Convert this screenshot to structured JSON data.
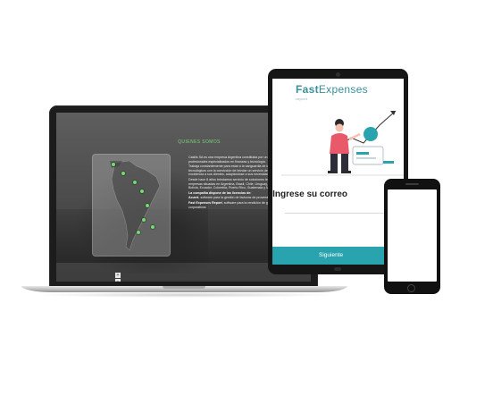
{
  "laptop": {
    "heading": "QUIENES SOMOS",
    "map_zoom": {
      "plus": "+",
      "minus": "−"
    },
    "paragraphs": [
      "Casilis SA es una empresa Argentina constituida por un grupo de profesionales especializados en finanzas y tecnología.",
      "Trabaja constantemente para estar a la vanguardia de los avances tecnológicos con la convicción de brindar un servicio de calidad y excelencia a sus clientes, adaptándose a sus necesidades.",
      "Desde hace 8 años brindamos servicio de soluciones tecnológicas a empresas situadas en Argentina, Brasil, Chile, Uruguay, Paraguay, Perú, Bolivia, Ecuador, Colombia, Puerto Rico, Guatemala y México."
    ],
    "licenses_title": "La compañía dispone de las licencias de:",
    "license_1_name": "Acuert",
    "license_1_desc": ", software para la gestión de facturas de proveedores",
    "license_2_name": "Fast Expenses Report",
    "license_2_desc": ", software para la rendición de gastos corporativos"
  },
  "tablet": {
    "logo_fast": "Fast",
    "logo_expenses": "Expenses",
    "logo_sub": "report",
    "prompt": "! Ingrese su correo",
    "next_button": "Siguiente"
  },
  "colors": {
    "accent": "#29a3ae",
    "map_pin": "#7cd47c"
  }
}
